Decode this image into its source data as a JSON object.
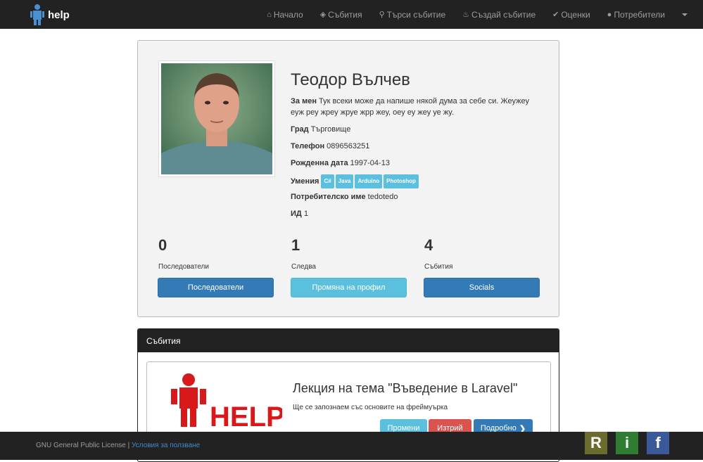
{
  "navbar": {
    "brand": "help",
    "items": [
      {
        "label": "Начало",
        "icon": "home-icon"
      },
      {
        "label": "Събития",
        "icon": "tags-icon"
      },
      {
        "label": "Търси събитие",
        "icon": "search-icon"
      },
      {
        "label": "Създай събитие",
        "icon": "fire-icon"
      },
      {
        "label": "Оценки",
        "icon": "check-circle-icon"
      },
      {
        "label": "Потребители",
        "icon": "user-icon"
      }
    ]
  },
  "profile": {
    "name": "Теодор Вълчев",
    "about_label": "За мен",
    "about": "Тук всеки може да напише някой дума за себе си. Жеужеу еуж реу жреу жруе жрр жеу, оеу еу жеу уе жу.",
    "city_label": "Град",
    "city": "Търговище",
    "phone_label": "Телефон",
    "phone": "0896563251",
    "birth_label": "Рожденна дата",
    "birth": "1997-04-13",
    "skills_label": "Умения",
    "skills": [
      "C#",
      "Java",
      "Arduino",
      "Photoshop"
    ],
    "username_label": "Потребителско име",
    "username": "tedotedo",
    "id_label": "ИД",
    "id": "1"
  },
  "stats": {
    "followers": {
      "value": "0",
      "label": "Последователи"
    },
    "following": {
      "value": "1",
      "label": "Следва"
    },
    "events": {
      "value": "4",
      "label": "Събития"
    }
  },
  "buttons": {
    "followers": "Последователи",
    "edit_profile": "Промяна на профил",
    "socials": "Socials"
  },
  "events": {
    "heading": "Събития",
    "items": [
      {
        "logo_text": "HELP",
        "title": "Лекция на тема \"Въведение в Laravel\"",
        "description": "Ще се запознаем със основите на фреймуърка",
        "edit": "Промени",
        "delete": "Изтрий",
        "details": "Подробно"
      }
    ]
  },
  "footer": {
    "license": "GNU General Public License |",
    "terms": "Условия за ползване",
    "social": [
      {
        "letter": "R",
        "color": "#6b6b2e"
      },
      {
        "letter": "i",
        "color": "#2e7d32"
      },
      {
        "letter": "f",
        "color": "#3b5998"
      }
    ]
  },
  "colors": {
    "navbar": "#222222",
    "primary": "#337ab7",
    "info": "#5bc0de",
    "danger": "#d9534f",
    "logo_red": "#d8191c"
  }
}
